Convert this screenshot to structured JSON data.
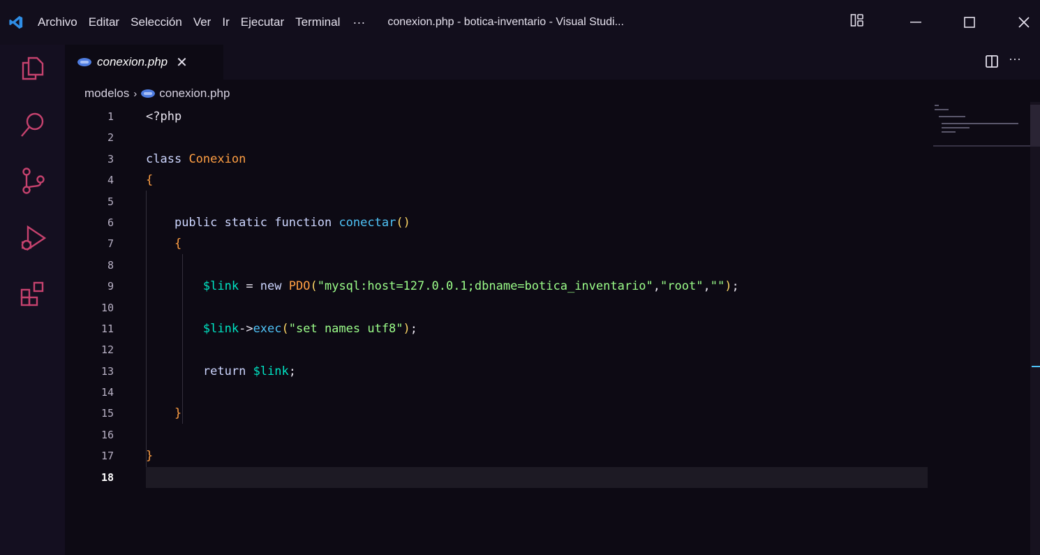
{
  "titlebar": {
    "menu": [
      "Archivo",
      "Editar",
      "Selección",
      "Ver",
      "Ir",
      "Ejecutar",
      "Terminal"
    ],
    "more": "···",
    "window_title": "conexion.php - botica-inventario - Visual Studi..."
  },
  "tab": {
    "label": "conexion.php",
    "close": "✕"
  },
  "editor_actions": {
    "more": "···"
  },
  "breadcrumb": {
    "folder": "modelos",
    "separator": "›",
    "file": "conexion.php"
  },
  "editor": {
    "active_line": 18,
    "line_numbers": [
      "1",
      "2",
      "3",
      "4",
      "5",
      "6",
      "7",
      "8",
      "9",
      "10",
      "11",
      "12",
      "13",
      "14",
      "15",
      "16",
      "17",
      "18"
    ],
    "lines": [
      "<?php",
      "",
      "class Conexion",
      "{",
      "",
      "    public static function conectar()",
      "    {",
      "",
      "        $link = new PDO(\"mysql:host=127.0.0.1;dbname=botica_inventario\",\"root\",\"\");",
      "",
      "        $link->exec(\"set names utf8\");",
      "",
      "        return $link;",
      "",
      "    }",
      "",
      "}",
      ""
    ]
  },
  "theme": {
    "background": "#0d0a14",
    "keyword": "#cdd6ff",
    "class_name": "#ff9f43",
    "function": "#4fc3f7",
    "string": "#9cff8a",
    "variable": "#00e5c4",
    "vscode_blue": "#2f8ee6"
  }
}
